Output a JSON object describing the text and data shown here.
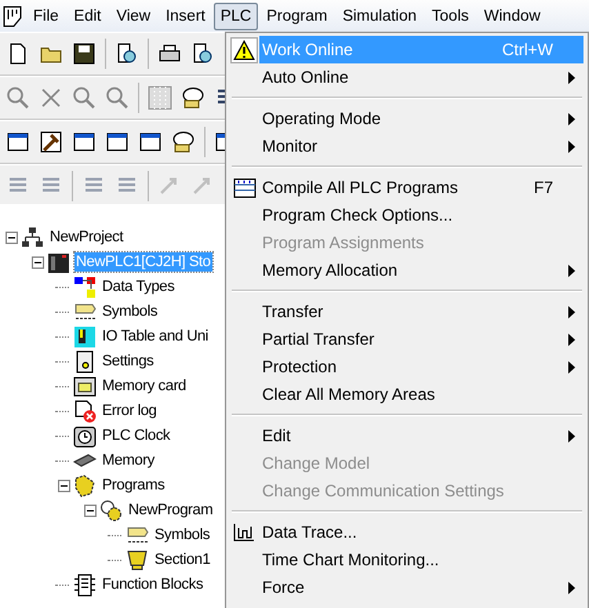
{
  "menubar": {
    "items": [
      {
        "label": "File",
        "selected": false
      },
      {
        "label": "Edit",
        "selected": false
      },
      {
        "label": "View",
        "selected": false
      },
      {
        "label": "Insert",
        "selected": false
      },
      {
        "label": "PLC",
        "selected": true
      },
      {
        "label": "Program",
        "selected": false
      },
      {
        "label": "Simulation",
        "selected": false
      },
      {
        "label": "Tools",
        "selected": false
      },
      {
        "label": "Window",
        "selected": false
      }
    ]
  },
  "tree": [
    {
      "label": "NewProject",
      "selected": false,
      "expanded": true,
      "children": [
        {
          "label": "NewPLC1[CJ2H] Sto",
          "selected": true,
          "expanded": true,
          "children": [
            {
              "label": "Data Types",
              "selected": false
            },
            {
              "label": "Symbols",
              "selected": false
            },
            {
              "label": "IO Table and Uni",
              "selected": false
            },
            {
              "label": "Settings",
              "selected": false
            },
            {
              "label": "Memory card",
              "selected": false
            },
            {
              "label": "Error log",
              "selected": false
            },
            {
              "label": "PLC Clock",
              "selected": false
            },
            {
              "label": "Memory",
              "selected": false
            },
            {
              "label": "Programs",
              "selected": false,
              "expanded": true,
              "children": [
                {
                  "label": "NewProgram",
                  "selected": false,
                  "expanded": true,
                  "children": [
                    {
                      "label": "Symbols",
                      "selected": false
                    },
                    {
                      "label": "Section1",
                      "selected": false
                    }
                  ]
                }
              ]
            },
            {
              "label": "Function Blocks",
              "selected": false
            }
          ]
        }
      ]
    }
  ],
  "plc_menu": {
    "items": [
      {
        "kind": "item",
        "label": "Work Online",
        "shortcut": "Ctrl+W",
        "highlighted": true,
        "disabled": false,
        "submenu": false
      },
      {
        "kind": "item",
        "label": "Auto Online",
        "highlighted": false,
        "disabled": false,
        "submenu": true
      },
      {
        "kind": "separator"
      },
      {
        "kind": "item",
        "label": "Operating Mode",
        "highlighted": false,
        "disabled": false,
        "submenu": true
      },
      {
        "kind": "item",
        "label": "Monitor",
        "highlighted": false,
        "disabled": false,
        "submenu": true
      },
      {
        "kind": "separator"
      },
      {
        "kind": "item",
        "label": "Compile All PLC Programs",
        "shortcut": "F7",
        "highlighted": false,
        "disabled": false,
        "submenu": false
      },
      {
        "kind": "item",
        "label": "Program Check Options...",
        "highlighted": false,
        "disabled": false,
        "submenu": false
      },
      {
        "kind": "item",
        "label": "Program Assignments",
        "highlighted": false,
        "disabled": true,
        "submenu": false
      },
      {
        "kind": "item",
        "label": "Memory Allocation",
        "highlighted": false,
        "disabled": false,
        "submenu": true
      },
      {
        "kind": "separator"
      },
      {
        "kind": "item",
        "label": "Transfer",
        "highlighted": false,
        "disabled": false,
        "submenu": true
      },
      {
        "kind": "item",
        "label": "Partial Transfer",
        "highlighted": false,
        "disabled": false,
        "submenu": true
      },
      {
        "kind": "item",
        "label": "Protection",
        "highlighted": false,
        "disabled": false,
        "submenu": true
      },
      {
        "kind": "item",
        "label": "Clear All Memory Areas",
        "highlighted": false,
        "disabled": false,
        "submenu": false
      },
      {
        "kind": "separator"
      },
      {
        "kind": "item",
        "label": "Edit",
        "highlighted": false,
        "disabled": false,
        "submenu": true
      },
      {
        "kind": "item",
        "label": "Change Model",
        "highlighted": false,
        "disabled": true,
        "submenu": false
      },
      {
        "kind": "item",
        "label": "Change Communication Settings",
        "highlighted": false,
        "disabled": true,
        "submenu": false
      },
      {
        "kind": "separator"
      },
      {
        "kind": "item",
        "label": "Data Trace...",
        "highlighted": false,
        "disabled": false,
        "submenu": false
      },
      {
        "kind": "item",
        "label": "Time Chart Monitoring...",
        "highlighted": false,
        "disabled": false,
        "submenu": false
      },
      {
        "kind": "item",
        "label": "Force",
        "highlighted": false,
        "disabled": false,
        "submenu": true
      }
    ]
  }
}
